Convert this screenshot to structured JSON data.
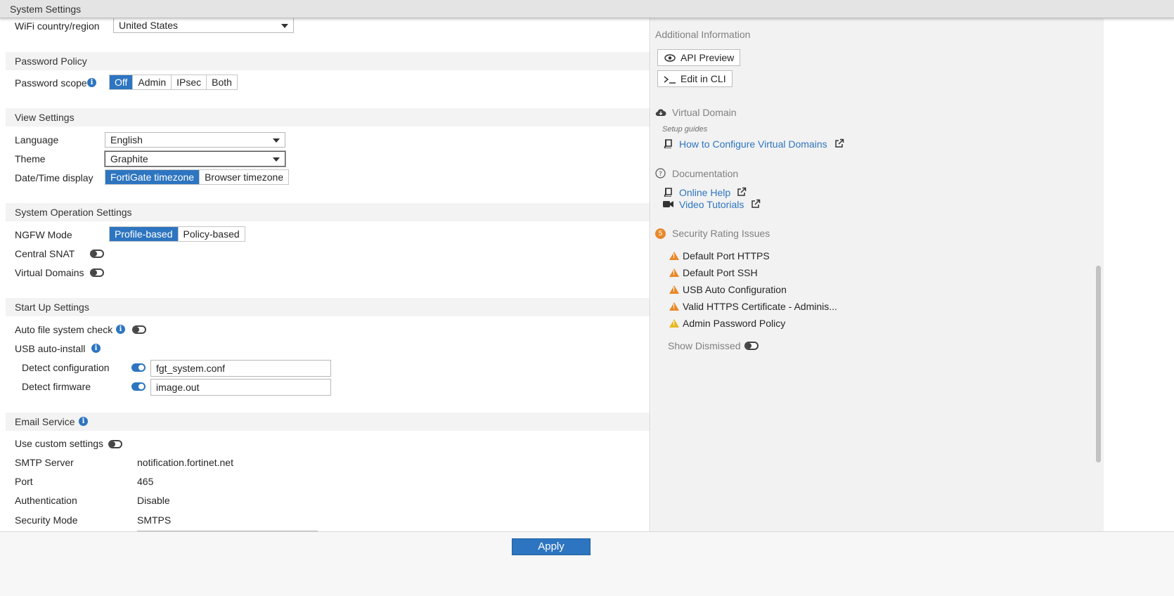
{
  "window": {
    "title": "System Settings"
  },
  "wifi": {
    "label": "WiFi country/region",
    "value": "United States"
  },
  "password_policy": {
    "header": "Password Policy",
    "scope_label": "Password scope",
    "options": [
      "Off",
      "Admin",
      "IPsec",
      "Both"
    ],
    "selected": "Off"
  },
  "view_settings": {
    "header": "View Settings",
    "language_label": "Language",
    "language_value": "English",
    "theme_label": "Theme",
    "theme_value": "Graphite",
    "datetime_label": "Date/Time display",
    "datetime_options": [
      "FortiGate timezone",
      "Browser timezone"
    ],
    "datetime_selected": "FortiGate timezone"
  },
  "system_operation": {
    "header": "System Operation Settings",
    "ngfw_label": "NGFW Mode",
    "ngfw_options": [
      "Profile-based",
      "Policy-based"
    ],
    "ngfw_selected": "Profile-based",
    "central_snat_label": "Central SNAT",
    "central_snat": false,
    "vdom_label": "Virtual Domains",
    "vdom": false
  },
  "startup": {
    "header": "Start Up Settings",
    "auto_fs_label": "Auto file system check",
    "auto_fs": false,
    "usb_label": "USB auto-install",
    "detect_config_label": "Detect configuration",
    "detect_config": true,
    "detect_config_value": "fgt_system.conf",
    "detect_fw_label": "Detect firmware",
    "detect_fw": true,
    "detect_fw_value": "image.out"
  },
  "email": {
    "header": "Email Service",
    "custom_label": "Use custom settings",
    "custom": false,
    "smtp_label": "SMTP Server",
    "smtp_value": "notification.fortinet.net",
    "port_label": "Port",
    "port_value": "465",
    "auth_label": "Authentication",
    "auth_value": "Disable",
    "security_label": "Security Mode",
    "security_value": "SMTPS"
  },
  "sidebar": {
    "additional_info": "Additional Information",
    "api_preview": "API Preview",
    "edit_cli": "Edit in CLI",
    "vdom_header": "Virtual Domain",
    "setup_guides": "Setup guides",
    "vdom_link": "How to Configure Virtual Domains",
    "doc_header": "Documentation",
    "online_help": "Online Help",
    "video_tutorials": "Video Tutorials",
    "security_count": "5",
    "security_header": "Security Rating Issues",
    "issues": [
      {
        "label": "Default Port HTTPS",
        "severity": "orange"
      },
      {
        "label": "Default Port SSH",
        "severity": "orange"
      },
      {
        "label": "USB Auto Configuration",
        "severity": "orange"
      },
      {
        "label": "Valid HTTPS Certificate - Adminis...",
        "severity": "orange"
      },
      {
        "label": "Admin Password Policy",
        "severity": "yellow"
      }
    ],
    "show_dismissed": "Show Dismissed",
    "show_dismissed_on": false
  },
  "footer": {
    "apply": "Apply"
  },
  "colors": {
    "accent": "#2d75c0",
    "warning_orange": "#e8882a",
    "warning_yellow": "#e7b81e"
  }
}
